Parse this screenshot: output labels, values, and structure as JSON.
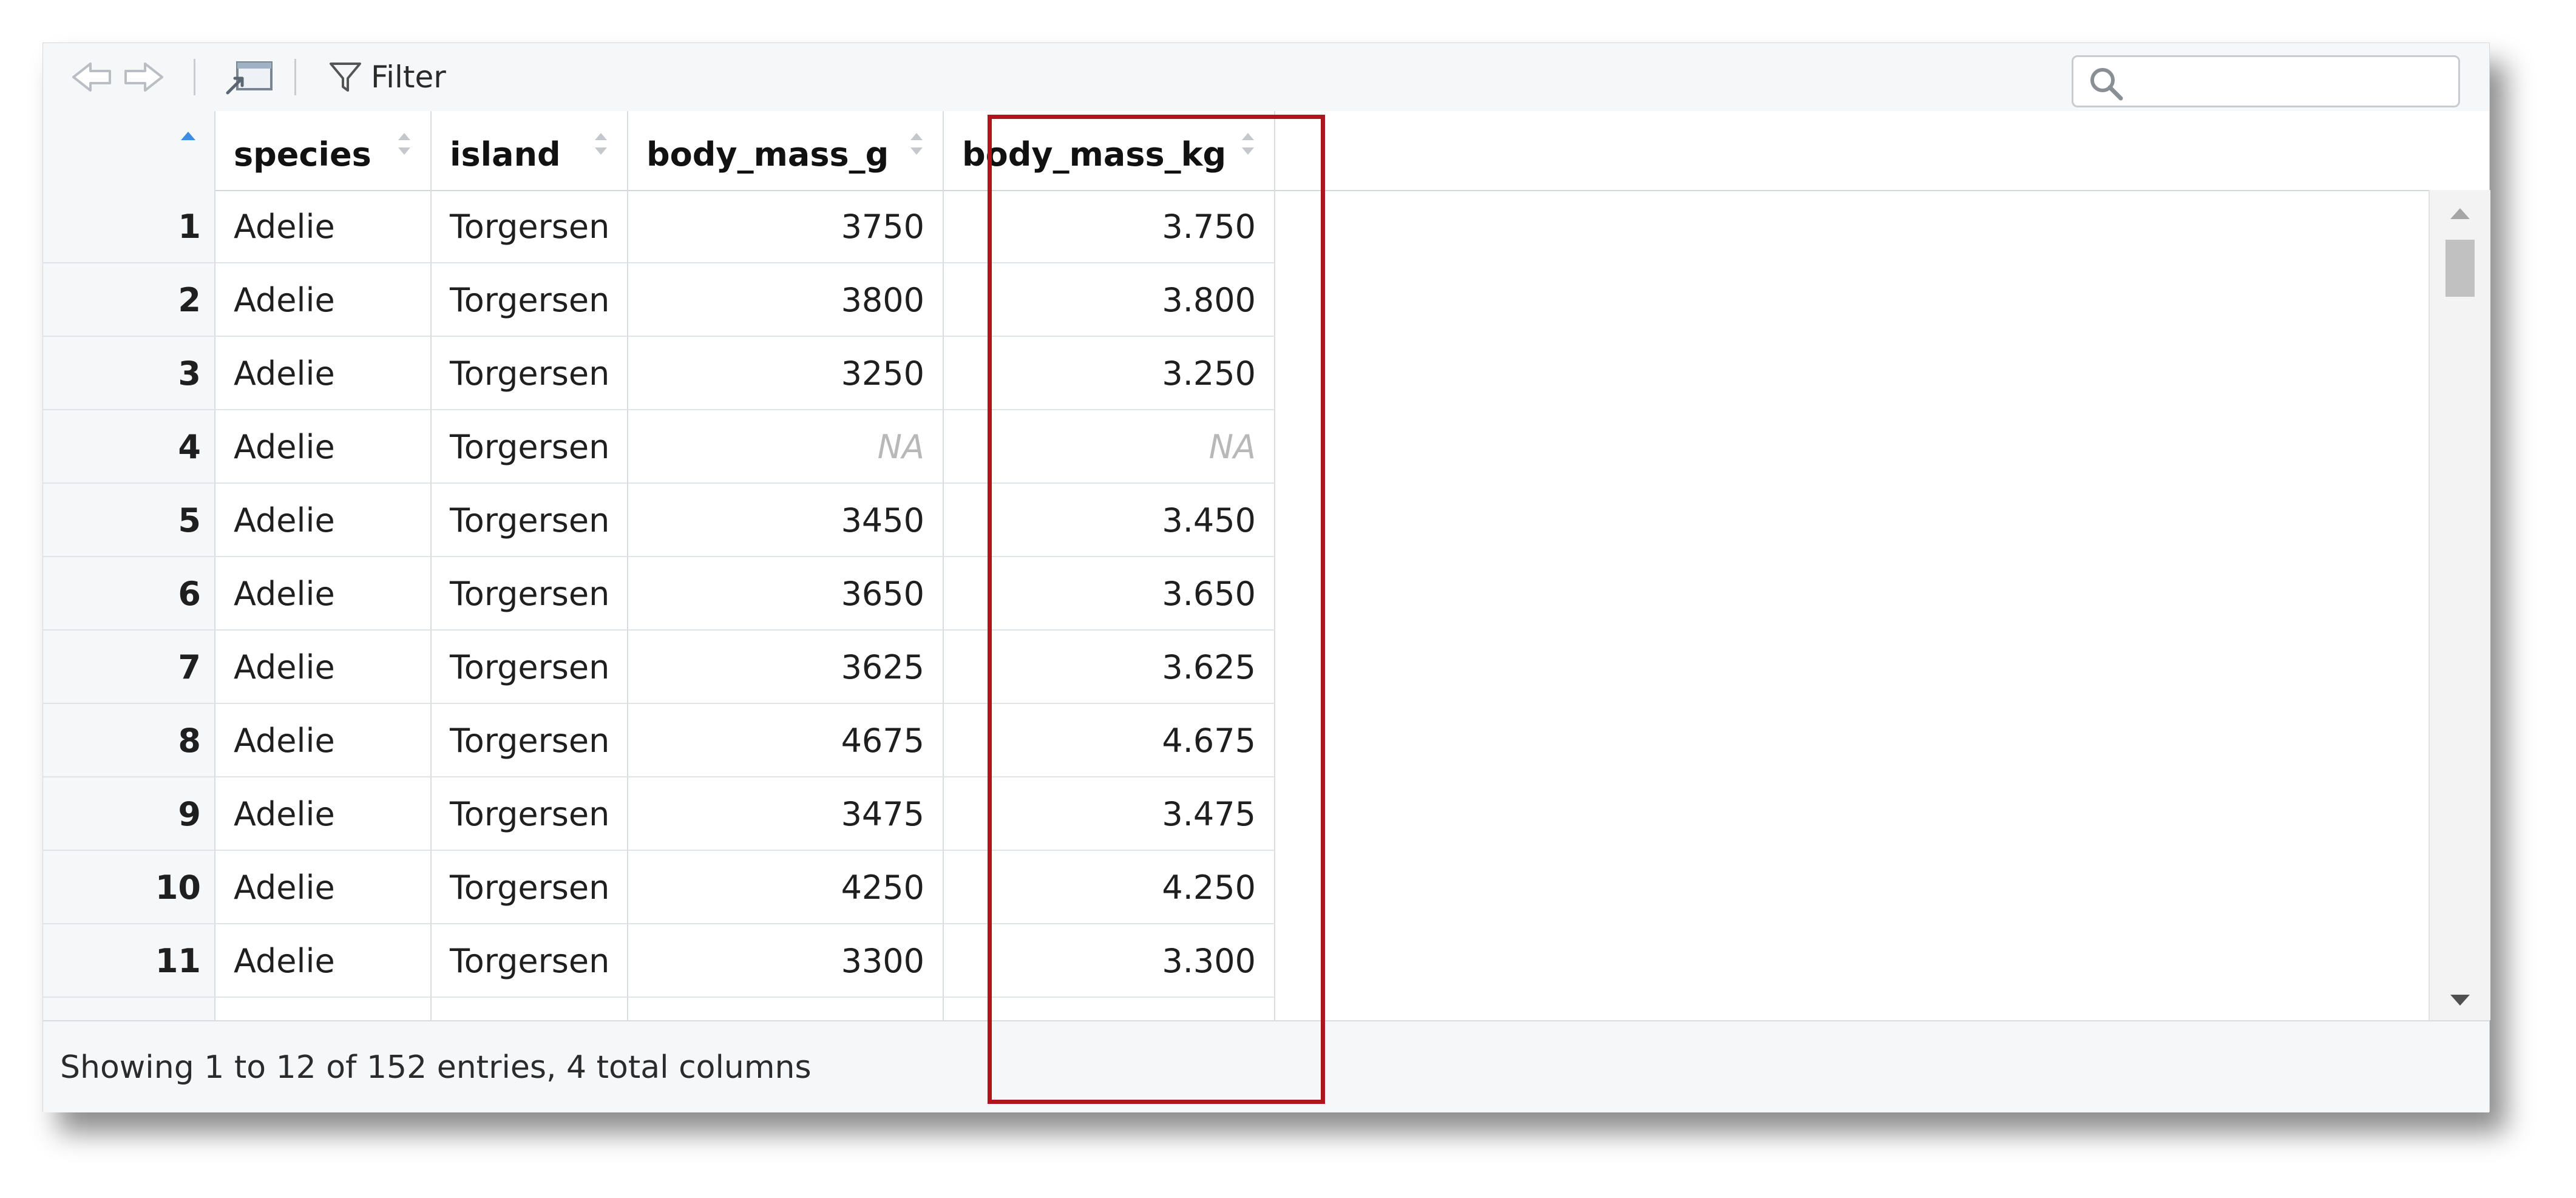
{
  "toolbar": {
    "back_icon": "arrow-left-icon",
    "forward_icon": "arrow-right-icon",
    "popout_icon": "popout-window-icon",
    "filter_label": "Filter",
    "filter_icon": "funnel-icon",
    "search": {
      "value": "",
      "placeholder": "",
      "icon": "search-icon"
    }
  },
  "table": {
    "columns": [
      "",
      "species",
      "island",
      "body_mass_g",
      "body_mass_kg"
    ],
    "sorted_column_index": 0,
    "rows": [
      [
        "1",
        "Adelie",
        "Torgersen",
        "3750",
        "3.750"
      ],
      [
        "2",
        "Adelie",
        "Torgersen",
        "3800",
        "3.800"
      ],
      [
        "3",
        "Adelie",
        "Torgersen",
        "3250",
        "3.250"
      ],
      [
        "4",
        "Adelie",
        "Torgersen",
        "NA",
        "NA"
      ],
      [
        "5",
        "Adelie",
        "Torgersen",
        "3450",
        "3.450"
      ],
      [
        "6",
        "Adelie",
        "Torgersen",
        "3650",
        "3.650"
      ],
      [
        "7",
        "Adelie",
        "Torgersen",
        "3625",
        "3.625"
      ],
      [
        "8",
        "Adelie",
        "Torgersen",
        "4675",
        "4.675"
      ],
      [
        "9",
        "Adelie",
        "Torgersen",
        "3475",
        "3.475"
      ],
      [
        "10",
        "Adelie",
        "Torgersen",
        "4250",
        "4.250"
      ],
      [
        "11",
        "Adelie",
        "Torgersen",
        "3300",
        "3.300"
      ]
    ]
  },
  "status": {
    "text": "Showing 1 to 12 of 152 entries, 4 total columns"
  },
  "colors": {
    "highlight": "#b0141c",
    "sort_active": "#3a8ee6",
    "na_text": "#b8b8b8",
    "header_bg": "#f5f7f9"
  }
}
